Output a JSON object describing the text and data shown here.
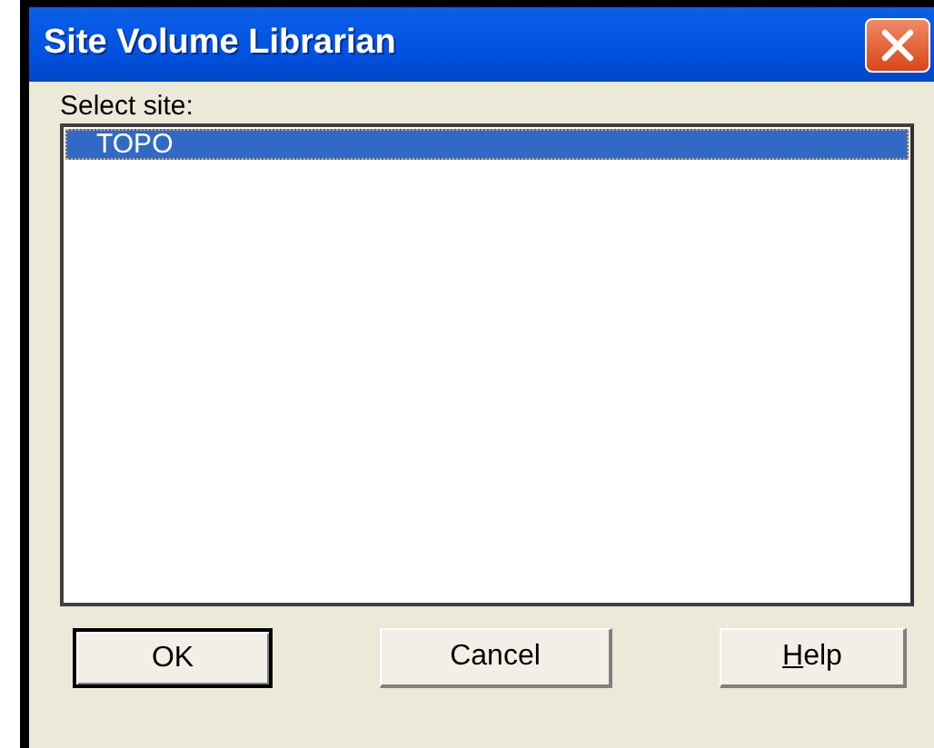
{
  "window": {
    "title": "Site Volume Librarian"
  },
  "site_list": {
    "label": "Select site:",
    "items": [
      {
        "text": "TOPO",
        "selected": true
      }
    ]
  },
  "buttons": [
    {
      "label": "OK",
      "default": true,
      "mnemonic_underlined": false
    },
    {
      "label": "Cancel",
      "default": false,
      "mnemonic_underlined": false
    },
    {
      "label": "Help",
      "default": false,
      "mnemonic_underlined": true
    }
  ]
}
